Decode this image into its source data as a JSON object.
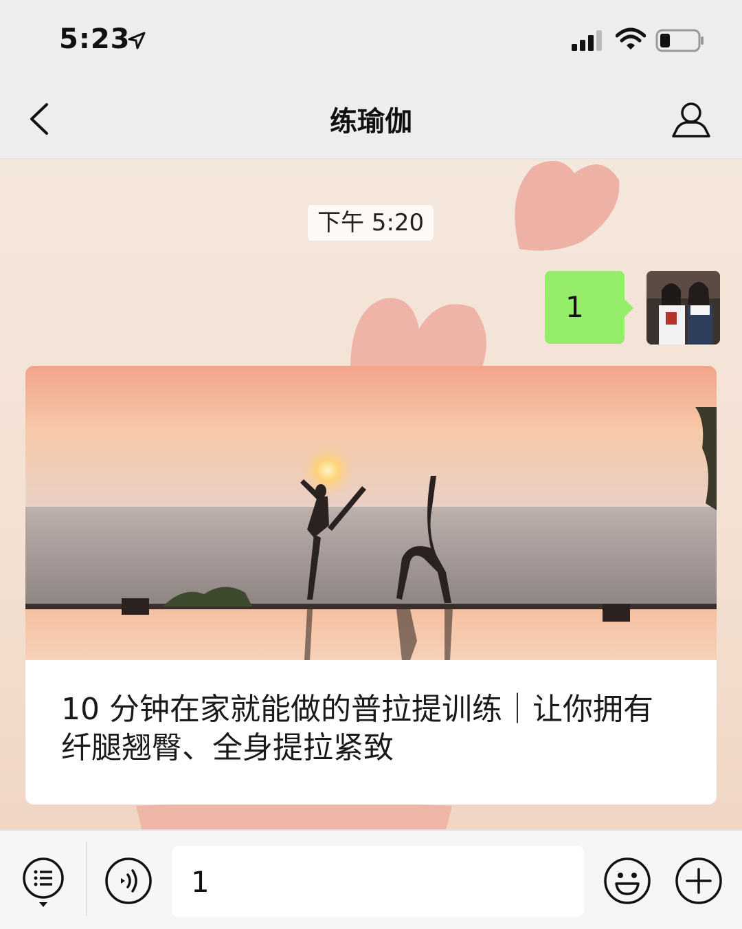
{
  "status_bar": {
    "time": "5:23"
  },
  "nav": {
    "title": "练瑜伽"
  },
  "chat": {
    "timestamp": "下午 5:20",
    "messages": [
      {
        "text": "1",
        "from": "me"
      }
    ],
    "article": {
      "title": "10 分钟在家就能做的普拉提训练｜让你拥有纤腿翘臀、全身提拉紧致"
    }
  },
  "input": {
    "value": "1"
  },
  "colors": {
    "bubble": "#95ec69",
    "nav_bg": "#ededed",
    "chat_bg": "#f3e3d6"
  },
  "icons": [
    "location-arrow-icon",
    "signal-icon",
    "wifi-icon",
    "battery-icon",
    "back-icon",
    "profile-icon",
    "menu-icon",
    "voice-icon",
    "emoji-icon",
    "plus-icon"
  ]
}
